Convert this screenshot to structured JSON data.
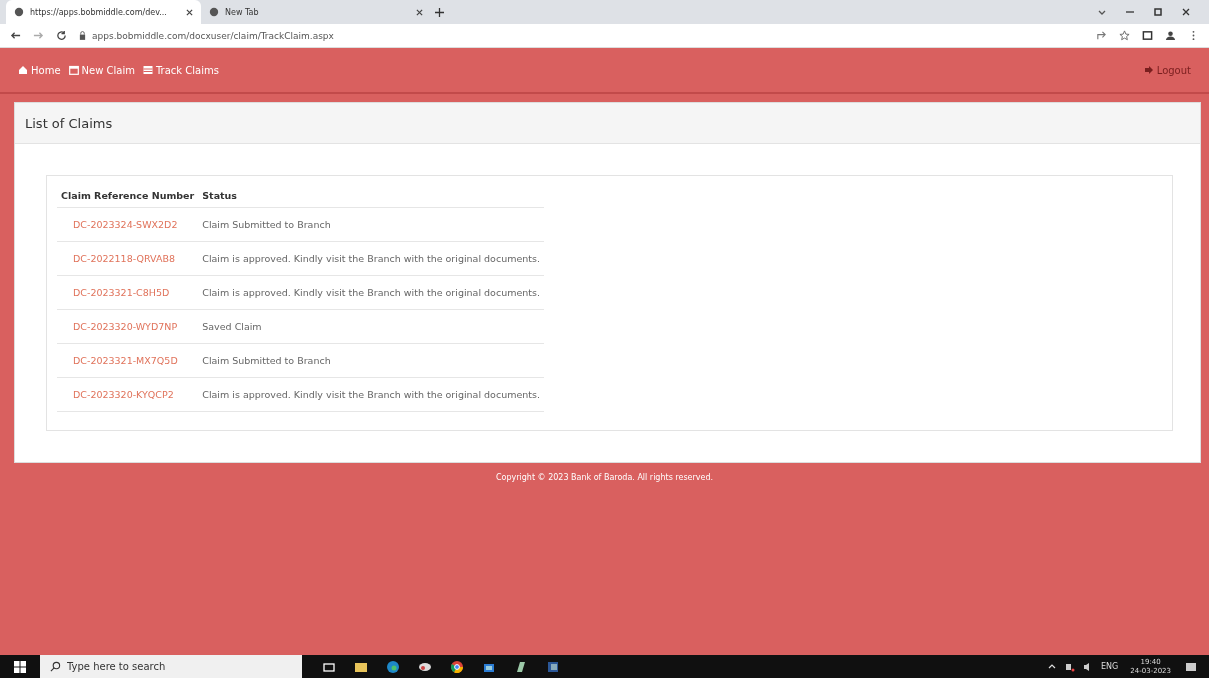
{
  "browser": {
    "tabs": [
      {
        "title": "https://apps.bobmiddle.com/dev...",
        "selected": true
      },
      {
        "title": "New Tab",
        "selected": false
      }
    ],
    "url": "apps.bobmiddle.com/docxuser/claim/TrackClaim.aspx"
  },
  "nav": {
    "items": [
      {
        "label": "Home"
      },
      {
        "label": "New Claim"
      },
      {
        "label": "Track Claims"
      }
    ],
    "logout": "Logout"
  },
  "card": {
    "title": "List of Claims",
    "table": {
      "columns": [
        "Claim Reference Number",
        "Status"
      ],
      "rows": [
        {
          "ref": "DC-2023324-SWX2D2",
          "status": "Claim Submitted to Branch"
        },
        {
          "ref": "DC-2022118-QRVAB8",
          "status": "Claim is approved. Kindly visit the Branch with the original documents."
        },
        {
          "ref": "DC-2023321-C8H5D",
          "status": "Claim is approved. Kindly visit the Branch with the original documents."
        },
        {
          "ref": "DC-2023320-WYD7NP",
          "status": "Saved Claim"
        },
        {
          "ref": "DC-2023321-MX7Q5D",
          "status": "Claim Submitted to Branch"
        },
        {
          "ref": "DC-2023320-KYQCP2",
          "status": "Claim is approved. Kindly visit the Branch with the original documents."
        }
      ]
    }
  },
  "footer": "Copyright © 2023 Bank of Baroda. All rights reserved.",
  "taskbar": {
    "search_placeholder": "Type here to search",
    "language": "ENG",
    "time": "19:40",
    "date": "24-03-2023"
  }
}
